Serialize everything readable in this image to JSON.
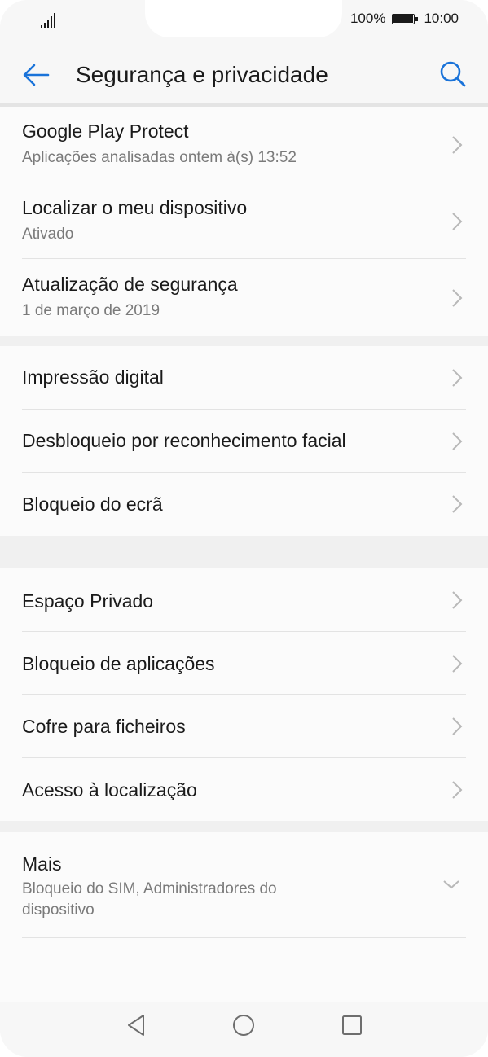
{
  "status_bar": {
    "signal_icon": "signal-bars-icon",
    "battery_percent": "100%",
    "battery_icon": "battery-full-icon",
    "time": "10:00"
  },
  "header": {
    "back_icon": "arrow-left-icon",
    "title": "Segurança e privacidade",
    "search_icon": "search-icon",
    "accent_color": "#1a73d9"
  },
  "sections": [
    {
      "items": [
        {
          "title": "Google Play Protect",
          "subtitle": "Aplicações analisadas ontem à(s) 13:52"
        },
        {
          "title": "Localizar o meu dispositivo",
          "subtitle": "Ativado"
        },
        {
          "title": "Atualização de segurança",
          "subtitle": "1 de março de 2019"
        }
      ]
    },
    {
      "items": [
        {
          "title": "Impressão digital"
        },
        {
          "title": "Desbloqueio por reconhecimento facial"
        },
        {
          "title": "Bloqueio do ecrã"
        }
      ]
    },
    {
      "items": [
        {
          "title": "Espaço Privado"
        },
        {
          "title": "Bloqueio de aplicações"
        },
        {
          "title": "Cofre para ficheiros"
        },
        {
          "title": "Acesso à localização"
        }
      ]
    },
    {
      "items": [
        {
          "title": "Mais",
          "subtitle": "Bloqueio do SIM, Administradores do dispositivo",
          "expand_icon": "chevron-down-icon"
        }
      ]
    }
  ],
  "nav_bar": {
    "back_icon": "triangle-back-icon",
    "home_icon": "circle-home-icon",
    "recents_icon": "square-recents-icon"
  }
}
